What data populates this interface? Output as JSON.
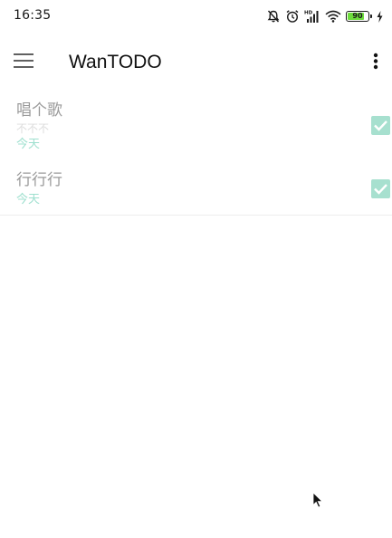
{
  "status_bar": {
    "time": "16:35",
    "battery_level": "90",
    "icons": [
      "mute-bell-icon",
      "alarm-icon",
      "hd-signal-icon",
      "wifi-icon",
      "battery-icon",
      "charging-icon"
    ]
  },
  "app_bar": {
    "title": "WanTODO",
    "menu_icon": "hamburger-menu-icon",
    "more_icon": "more-vertical-icon"
  },
  "todos": [
    {
      "title": "唱个歌",
      "content": "不不不",
      "date": "今天",
      "done": true
    },
    {
      "title": "行行行",
      "content": "",
      "date": "今天",
      "done": true
    }
  ],
  "colors": {
    "accent": "#a7e0cf",
    "date_text": "#9fe0cf",
    "title_text": "#9a9a9a",
    "battery_fill": "#6ddc3c"
  }
}
